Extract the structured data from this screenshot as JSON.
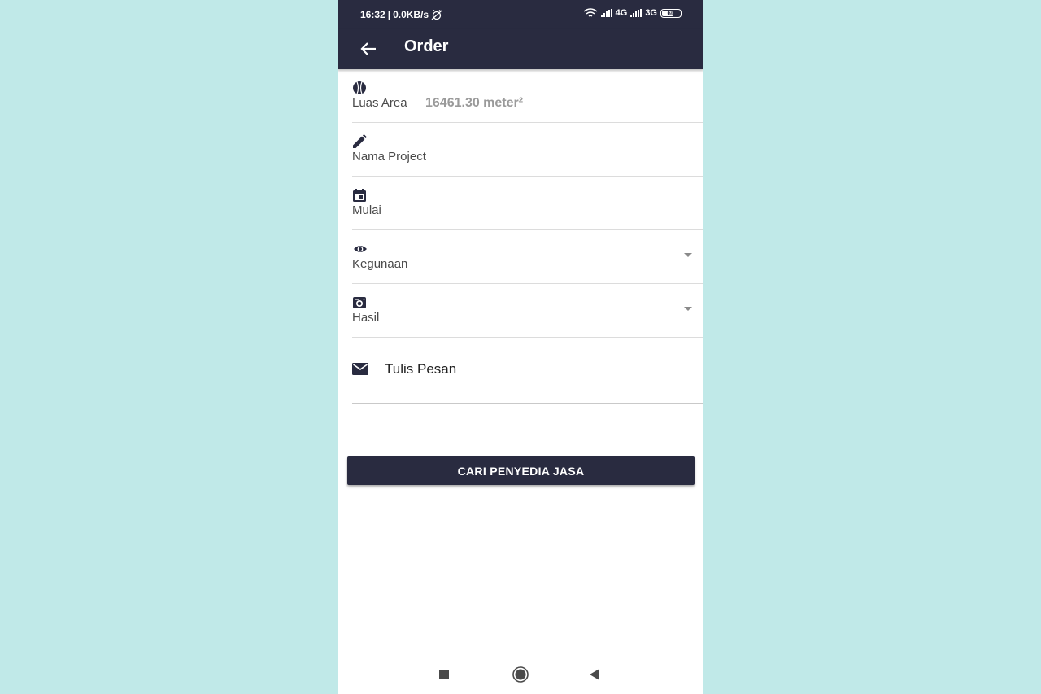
{
  "statusbar": {
    "time": "16:32",
    "separator": "|",
    "net_speed": "0.0KB/s",
    "network_1": "4G",
    "network_2": "3G",
    "battery": "60",
    "battery_level": 0.6
  },
  "appbar": {
    "title": "Order",
    "back_icon": "arrow-left-icon"
  },
  "form": {
    "luas_area": {
      "icon": "ball-icon",
      "label": "Luas Area",
      "value": "16461.30 meter²"
    },
    "nama_project": {
      "icon": "pencil-icon",
      "label": "Nama Project"
    },
    "mulai": {
      "icon": "calendar-icon",
      "label": "Mulai"
    },
    "kegunaan": {
      "icon": "eye-icon",
      "label": "Kegunaan"
    },
    "hasil": {
      "icon": "camera-icon",
      "label": "Hasil"
    },
    "pesan": {
      "icon": "mail-icon",
      "label": "Tulis Pesan"
    }
  },
  "cta": {
    "label": "CARI PENYEDIA JASA"
  },
  "navbar": {
    "recent_icon": "square-icon",
    "home_icon": "circle-icon",
    "back_icon": "triangle-back-icon"
  },
  "colors": {
    "primary": "#292b40",
    "background": "#c0e9e8",
    "value_text": "#9a9a9a"
  }
}
